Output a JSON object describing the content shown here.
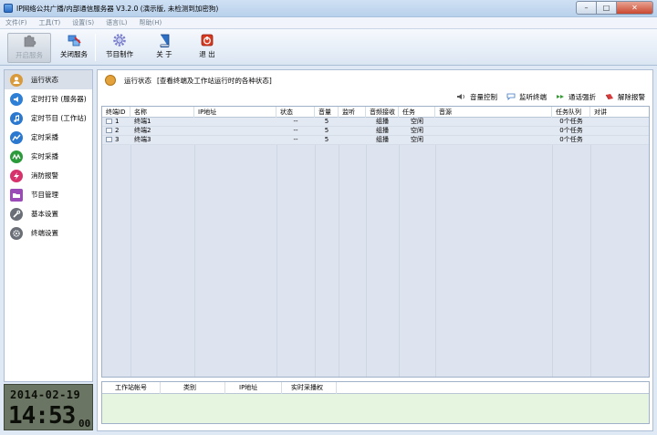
{
  "window": {
    "title": "IP网络公共广播/内部通信服务器 V3.2.0 (演示版, 未检测到加密狗)",
    "controls": {
      "minimize": "–",
      "maximize": "□",
      "close": "✕"
    }
  },
  "menu": [
    "文件(F)",
    "工具(T)",
    "设置(S)",
    "语言(L)",
    "帮助(H)"
  ],
  "toolbar": {
    "start_service": "开启服务",
    "close_service": "关闭服务",
    "program_make": "节目制作",
    "about": "关 于",
    "exit": "退 出"
  },
  "sidebar": {
    "items": [
      {
        "label": "运行状态",
        "icon": "person-icon",
        "color": "#d89a3a"
      },
      {
        "label": "定时打铃 (服务器)",
        "icon": "speaker-icon",
        "color": "#2e7fd6"
      },
      {
        "label": "定时节目 (工作站)",
        "icon": "music-note-icon",
        "color": "#2a78cf"
      },
      {
        "label": "定时采播",
        "icon": "chart-icon",
        "color": "#2a78cf"
      },
      {
        "label": "实时采播",
        "icon": "wave-icon",
        "color": "#2a9a3a"
      },
      {
        "label": "消防报警",
        "icon": "lightning-icon",
        "color": "#d6336c"
      },
      {
        "label": "节目管理",
        "icon": "folder-icon",
        "color": "#9a4bb8"
      },
      {
        "label": "基本设置",
        "icon": "wrench-icon",
        "color": "#6a6f77"
      },
      {
        "label": "终端设置",
        "icon": "gear-icon",
        "color": "#6a6f77"
      }
    ]
  },
  "clock": {
    "date": "2014-02-19",
    "time": "14:53",
    "seconds": "00"
  },
  "status_header": {
    "title": "运行状态",
    "description": "[查看终端及工作站运行时的各种状态]"
  },
  "actions": [
    {
      "label": "音量控制",
      "icon": "volume-icon"
    },
    {
      "label": "监听终端",
      "icon": "chat-icon"
    },
    {
      "label": "通话强折",
      "icon": "call-icon"
    },
    {
      "label": "解除报警",
      "icon": "alarm-icon"
    }
  ],
  "terminal_table": {
    "columns": [
      "终端ID",
      "名称",
      "IP地址",
      "状态",
      "音量",
      "监听",
      "音频接收",
      "任务",
      "音源",
      "任务队列",
      "对讲"
    ],
    "rows": [
      [
        "1",
        "终端1",
        "",
        "--",
        "5",
        "",
        "组播",
        "空闲",
        "",
        "0个任务",
        ""
      ],
      [
        "2",
        "终端2",
        "",
        "--",
        "5",
        "",
        "组播",
        "空闲",
        "",
        "0个任务",
        ""
      ],
      [
        "3",
        "终端3",
        "",
        "--",
        "5",
        "",
        "组播",
        "空闲",
        "",
        "0个任务",
        ""
      ]
    ]
  },
  "workstation_table": {
    "columns": [
      "工作站帐号",
      "类别",
      "IP地址",
      "实时采播权"
    ]
  }
}
